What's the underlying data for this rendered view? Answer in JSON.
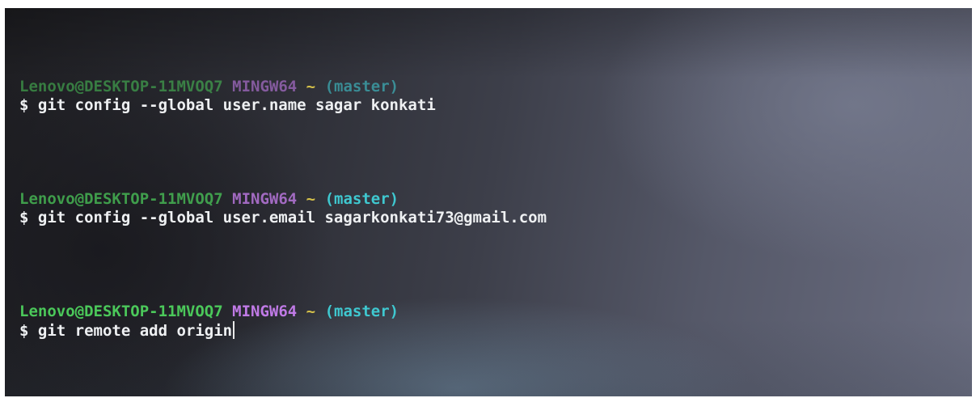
{
  "terminal": {
    "lines": [
      {
        "user_host": "Lenovo@DESKTOP-11MVOQ7",
        "system": "MINGW64",
        "path": "~",
        "branch": "(master)",
        "command": "$ git config --global user.name sagar konkati"
      },
      {
        "user_host": "Lenovo@DESKTOP-11MVOQ7",
        "system": "MINGW64",
        "path": "~",
        "branch": "(master)",
        "command": "$ git config --global user.email sagarkonkati73@gmail.com"
      },
      {
        "user_host": "Lenovo@DESKTOP-11MVOQ7",
        "system": "MINGW64",
        "path": "~",
        "branch": "(master)",
        "command": "$ git remote add origin"
      }
    ]
  },
  "colors": {
    "user_host": "#4bc85a",
    "system": "#c07ae6",
    "path": "#d6c24a",
    "branch": "#3fc8d0",
    "command": "#eef0f2"
  }
}
